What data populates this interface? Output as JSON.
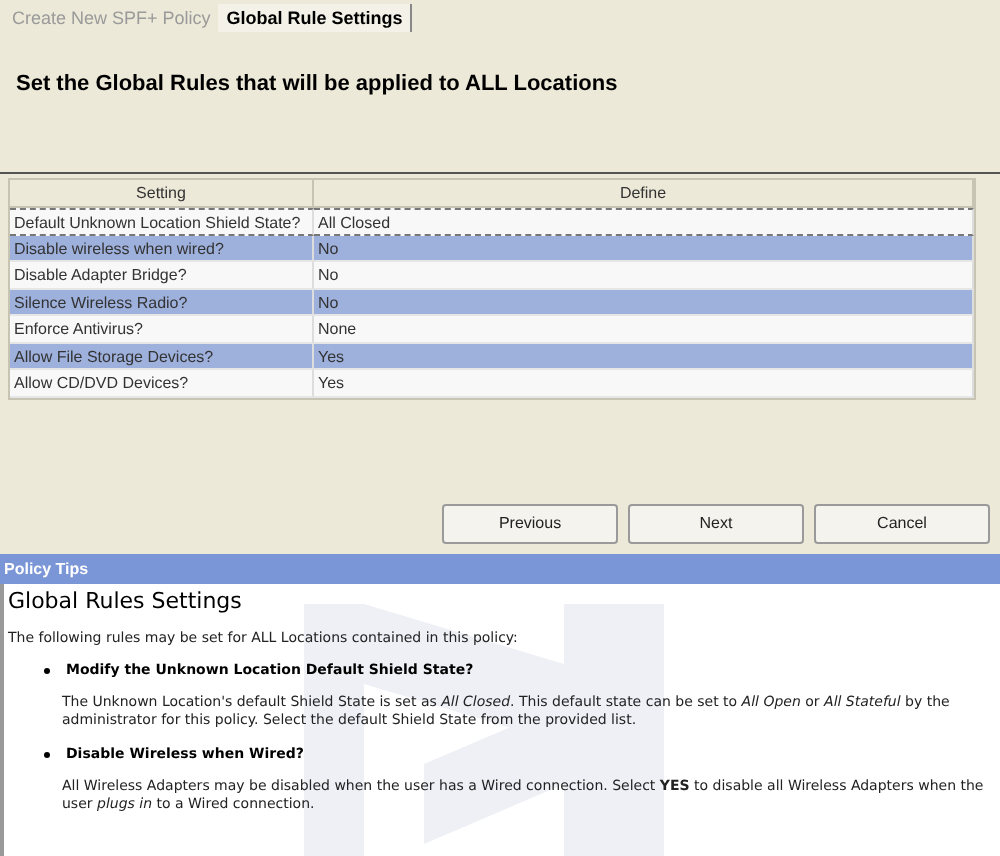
{
  "tabs": [
    {
      "label": "Create New SPF+ Policy",
      "selected": false
    },
    {
      "label": "Global Rule Settings",
      "selected": true
    }
  ],
  "heading": "Set the Global Rules that will be applied to ALL Locations",
  "table": {
    "columns": [
      "Setting",
      "Define"
    ],
    "rows": [
      {
        "setting": "Default Unknown Location Shield State?",
        "define": "All Closed",
        "focused": true
      },
      {
        "setting": "Disable wireless when wired?",
        "define": "No",
        "focused": false
      },
      {
        "setting": "Disable Adapter Bridge?",
        "define": "No",
        "focused": false
      },
      {
        "setting": "Silence Wireless Radio?",
        "define": "No",
        "focused": false
      },
      {
        "setting": "Enforce Antivirus?",
        "define": "None",
        "focused": false
      },
      {
        "setting": "Allow File Storage Devices?",
        "define": "Yes",
        "focused": false
      },
      {
        "setting": "Allow CD/DVD Devices?",
        "define": "Yes",
        "focused": false
      }
    ]
  },
  "buttons": [
    "Previous",
    "Next",
    "Cancel"
  ],
  "tips": {
    "header": "Policy Tips",
    "title": "Global Rules Settings",
    "intro": "The following rules may be set for ALL Locations contained in this policy:",
    "items": [
      {
        "heading": "Modify the Unknown Location Default Shield State?",
        "text": "The Unknown Location's default Shield State is set as *All Closed*. This default state can be set to *All Open* or *All Stateful* by the administrator for this policy. Select the default Shield State from the provided list."
      },
      {
        "heading": "Disable Wireless when Wired?",
        "text": "All Wireless Adapters may be disabled when the user has a Wired connection. Select **YES** to disable all Wireless Adapters when the user *plugs in* to a Wired connection."
      }
    ]
  }
}
